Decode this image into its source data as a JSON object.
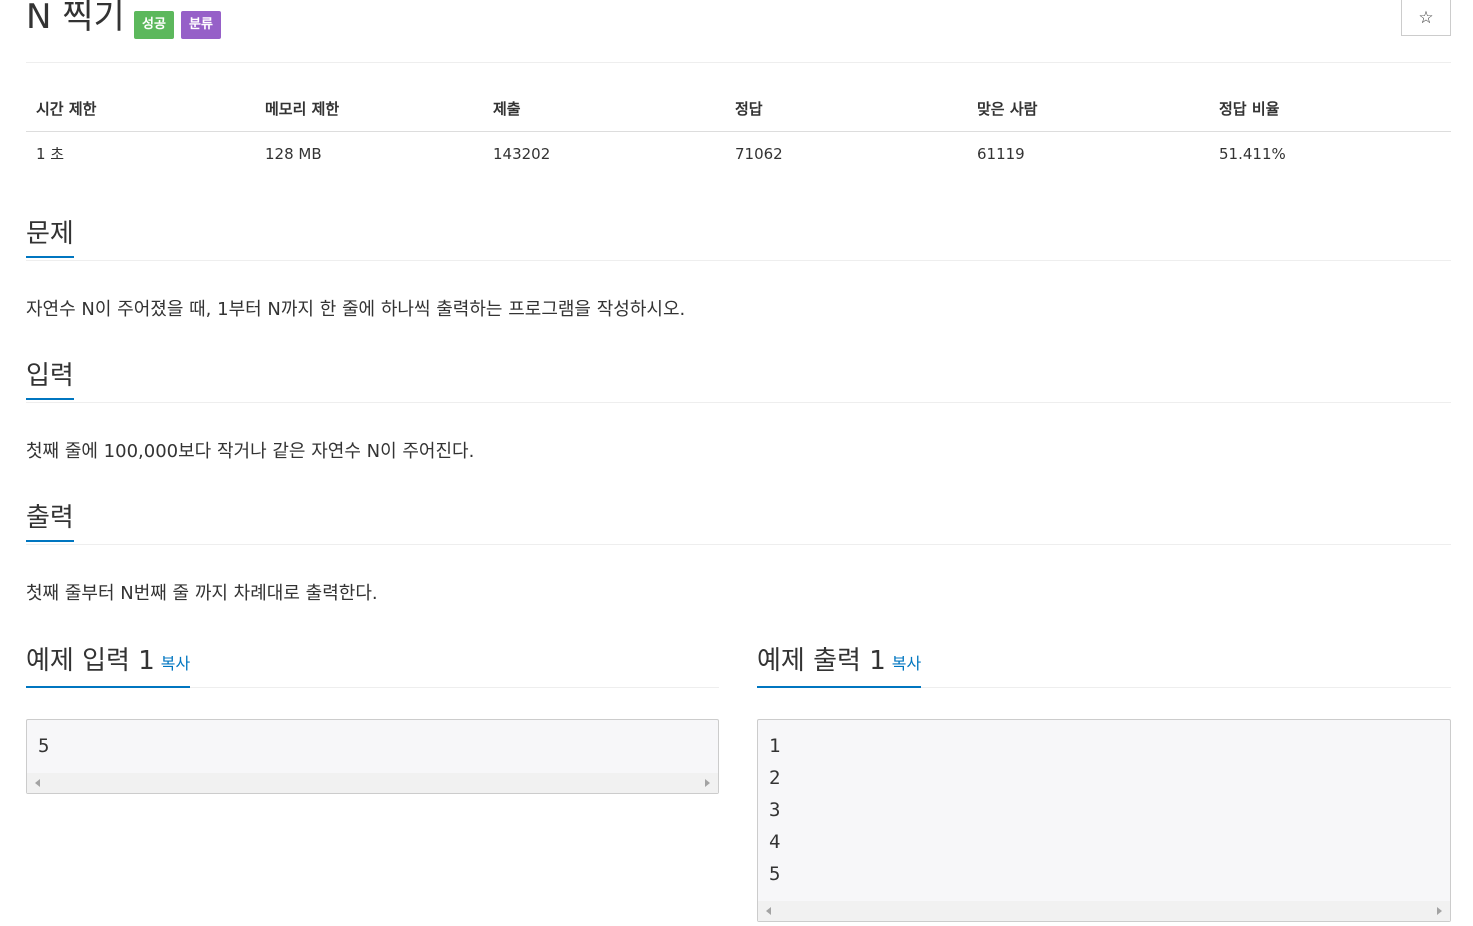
{
  "header": {
    "title": "N 찍기",
    "badges": {
      "success": "성공",
      "category": "분류"
    },
    "star_icon": "☆"
  },
  "info": {
    "headers": [
      "시간 제한",
      "메모리 제한",
      "제출",
      "정답",
      "맞은 사람",
      "정답 비율"
    ],
    "values": [
      "1 초",
      "128 MB",
      "143202",
      "71062",
      "61119",
      "51.411%"
    ]
  },
  "sections": {
    "problem": {
      "heading": "문제",
      "text": "자연수 N이 주어졌을 때, 1부터 N까지 한 줄에 하나씩 출력하는 프로그램을 작성하시오."
    },
    "input": {
      "heading": "입력",
      "text": "첫째 줄에 100,000보다 작거나 같은 자연수 N이 주어진다."
    },
    "output": {
      "heading": "출력",
      "text": "첫째 줄부터 N번째 줄 까지 차례대로 출력한다."
    }
  },
  "samples": {
    "input": {
      "heading": "예제 입력 1",
      "copy": "복사",
      "lines": [
        "5"
      ]
    },
    "output": {
      "heading": "예제 출력 1",
      "copy": "복사",
      "lines": [
        "1",
        "2",
        "3",
        "4",
        "5"
      ]
    }
  },
  "colors": {
    "accent": "#0076c0",
    "success_badge": "#5cb85c",
    "category_badge": "#9660c8"
  }
}
